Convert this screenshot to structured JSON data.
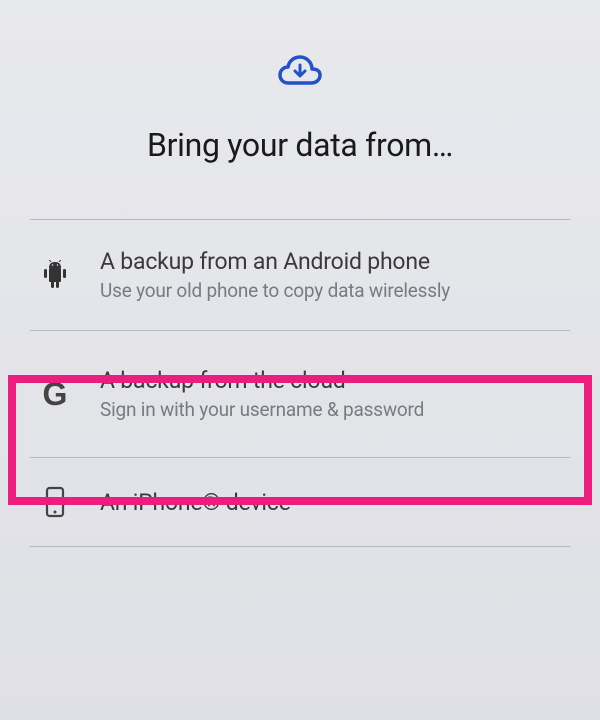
{
  "header": {
    "title": "Bring your data from…",
    "icon": "cloud-download"
  },
  "options": [
    {
      "icon": "android",
      "title": "A backup from an Android phone",
      "subtitle": "Use your old phone to copy data wirelessly"
    },
    {
      "icon": "google-g",
      "title": "A backup from the cloud",
      "subtitle": "Sign in with your username & password"
    },
    {
      "icon": "iphone",
      "title": "An iPhone® device",
      "subtitle": ""
    }
  ],
  "highlight": {
    "target_index": 1,
    "color": "#ed1d7f"
  }
}
